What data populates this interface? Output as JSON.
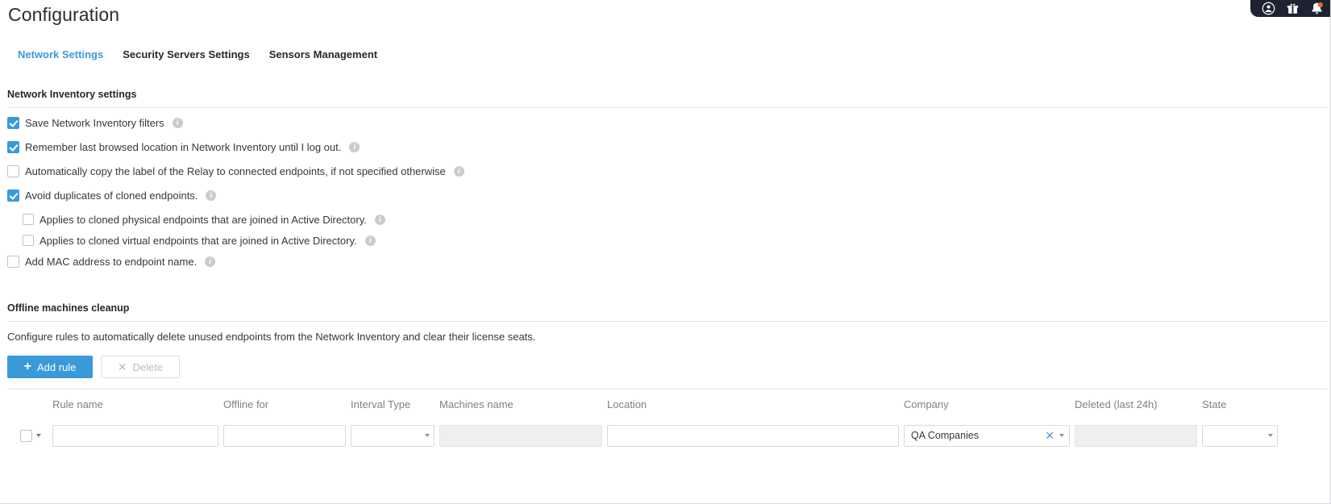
{
  "topbar": {
    "icons": [
      {
        "name": "account-icon",
        "glyph": "account"
      },
      {
        "name": "gift-icon",
        "glyph": "gift"
      },
      {
        "name": "notifications-bell-icon",
        "glyph": "bell"
      }
    ],
    "background_color": "#1d2331",
    "accent_color": "#f26722"
  },
  "header": {
    "title": "Configuration"
  },
  "tabs": [
    {
      "label": "Network Settings",
      "active": true
    },
    {
      "label": "Security Servers Settings",
      "active": false
    },
    {
      "label": "Sensors Management",
      "active": false
    }
  ],
  "network_inventory": {
    "section_title": "Network Inventory settings",
    "options": [
      {
        "label": "Save Network Inventory filters",
        "checked": true,
        "indent": false,
        "info": "i"
      },
      {
        "label": "Remember last browsed location in Network Inventory until I log out.",
        "checked": true,
        "indent": false,
        "info": "i"
      },
      {
        "label": "Automatically copy the label of the Relay to connected endpoints, if not specified otherwise",
        "checked": false,
        "indent": false,
        "info": "i"
      },
      {
        "label": "Avoid duplicates of cloned endpoints.",
        "checked": true,
        "indent": false,
        "info": "i"
      },
      {
        "label": "Applies to cloned physical endpoints that are joined in Active Directory.",
        "checked": false,
        "indent": true,
        "info": "i"
      },
      {
        "label": "Applies to cloned virtual endpoints that are joined in Active Directory.",
        "checked": false,
        "indent": true,
        "info": "i"
      },
      {
        "label": "Add MAC address to endpoint name.",
        "checked": false,
        "indent": false,
        "info": "i"
      }
    ]
  },
  "offline_cleanup": {
    "section_title": "Offline machines cleanup",
    "description": "Configure rules to automatically delete unused endpoints from the Network Inventory and clear their license seats.",
    "add_rule_label": "Add rule",
    "add_rule_icon": "plus-icon",
    "delete_label": "Delete",
    "delete_icon": "x-icon",
    "delete_disabled": true
  },
  "rules_table": {
    "columns": [
      "Rule name",
      "Offline for",
      "Interval Type",
      "Machines name",
      "Location",
      "Company",
      "Deleted (last 24h)",
      "State"
    ],
    "row": {
      "selected": false,
      "rule_name": "",
      "rule_name_placeholder": "",
      "offline_for": "",
      "offline_for_placeholder": "",
      "interval_type": "",
      "machines_name": "",
      "machines_name_readonly": true,
      "location": "",
      "location_placeholder": "",
      "company": "QA Companies",
      "company_clear_icon": "clear-x-icon",
      "deleted_last_24h": "",
      "deleted_readonly": true,
      "state": ""
    }
  },
  "colors": {
    "accent_blue": "#3a9ad9",
    "text": "#35373d",
    "muted": "#7d8289",
    "border": "#d7dade"
  }
}
